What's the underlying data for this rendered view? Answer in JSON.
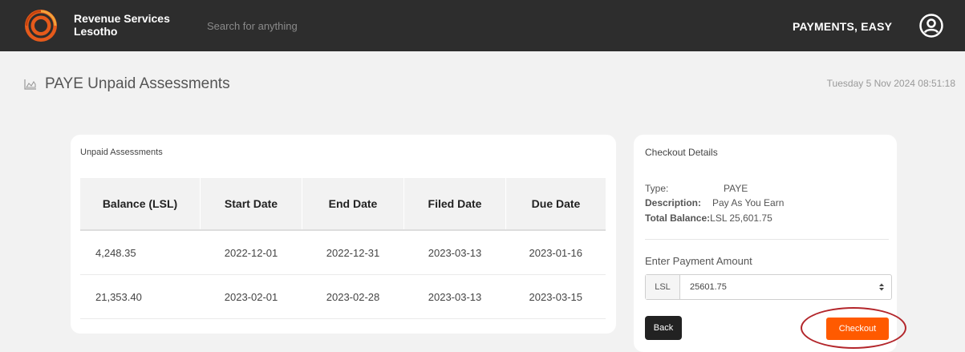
{
  "header": {
    "brand_line1": "Revenue Services",
    "brand_line2": "Lesotho",
    "search_placeholder": "Search for anything",
    "slogan": "PAYMENTS, EASY",
    "user_icon": "user-circle-icon",
    "logo_colors": [
      "#e55a1b",
      "#f2a33a"
    ]
  },
  "page": {
    "title_icon": "area-chart-icon",
    "title": "PAYE Unpaid Assessments",
    "datetime": "Tuesday 5 Nov 2024 08:51:18"
  },
  "assessments": {
    "title": "Unpaid Assessments",
    "columns": [
      "Balance (LSL)",
      "Start Date",
      "End Date",
      "Filed Date",
      "Due Date"
    ],
    "rows": [
      [
        "4,248.35",
        "2022-12-01",
        "2022-12-31",
        "2023-03-13",
        "2023-01-16"
      ],
      [
        "21,353.40",
        "2023-02-01",
        "2023-02-28",
        "2023-03-13",
        "2023-03-15"
      ]
    ]
  },
  "checkout": {
    "title": "Checkout Details",
    "type_label": "Type:",
    "type_value": "PAYE",
    "desc_label": "Description:",
    "desc_value": "Pay As You Earn",
    "total_label": "Total Balance:",
    "total_value": "LSL 25,601.75",
    "amount_label": "Enter Payment Amount",
    "currency": "LSL",
    "amount_value": "25601.75",
    "back_label": "Back",
    "checkout_label": "Checkout",
    "accent_color": "#ff5a00"
  }
}
